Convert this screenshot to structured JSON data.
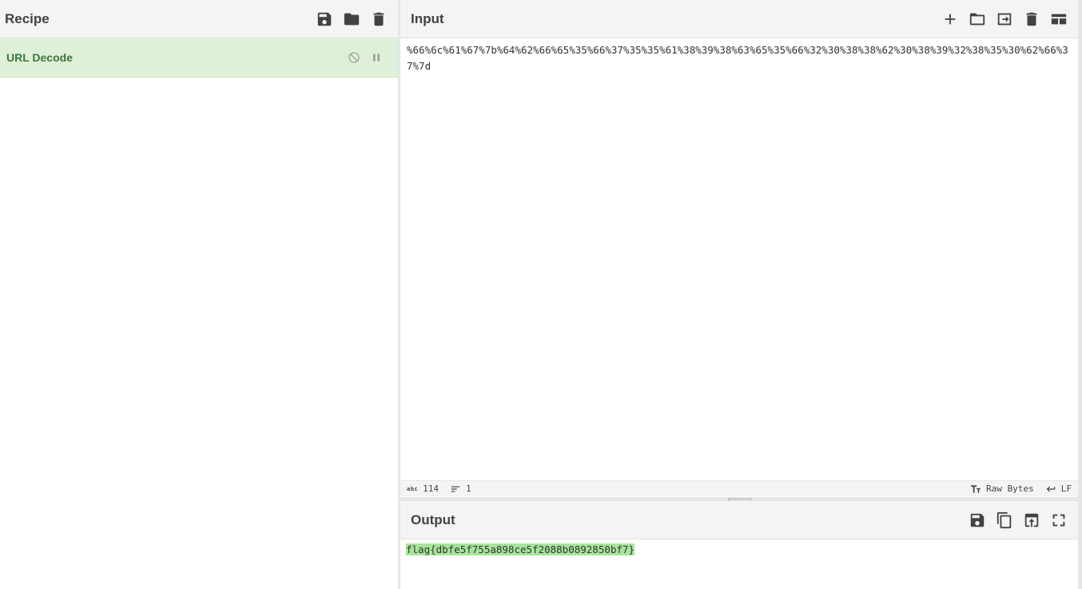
{
  "recipe": {
    "title": "Recipe",
    "operations": [
      {
        "name": "URL Decode"
      }
    ]
  },
  "input": {
    "title": "Input",
    "text": "%66%6c%61%67%7b%64%62%66%65%35%66%37%35%35%61%38%39%38%63%65%35%66%32%30%38%38%62%30%38%39%32%38%35%30%62%66%37%7d",
    "status": {
      "abc_label": "abc",
      "length": "114",
      "lines": "1",
      "encoding": "Raw Bytes",
      "eol": "LF"
    }
  },
  "output": {
    "title": "Output",
    "text": "flag{dbfe5f755a898ce5f2088b0892850bf7}",
    "highlight_color": "#a6e59a"
  },
  "colors": {
    "operation_bg": "#dff0d8",
    "operation_text": "#3c763d",
    "header_bg": "#f4f4f4"
  }
}
